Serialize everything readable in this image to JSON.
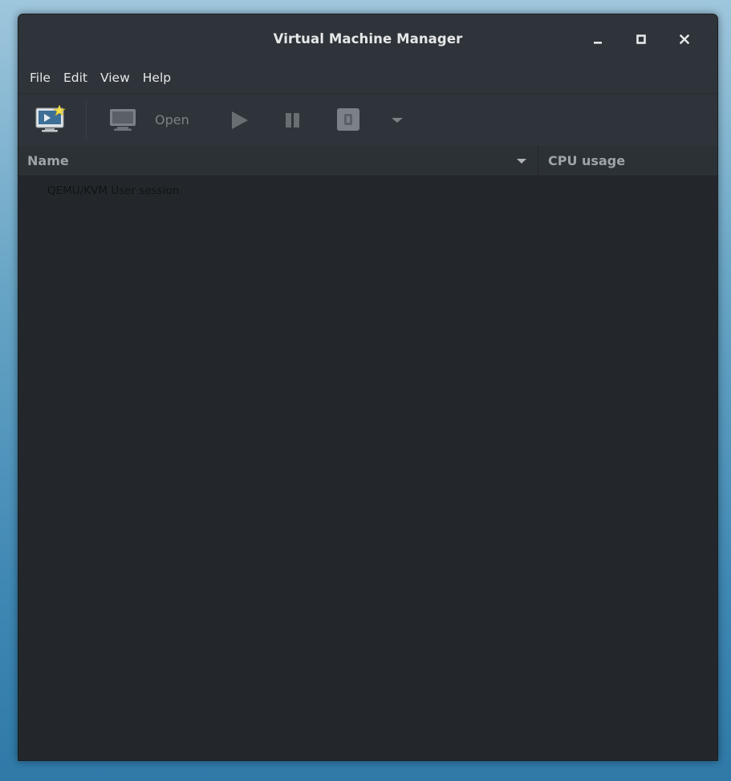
{
  "window": {
    "title": "Virtual Machine Manager"
  },
  "window_controls": {
    "minimize": "minimize-icon",
    "maximize": "maximize-icon",
    "close": "close-icon"
  },
  "menubar": {
    "items": [
      {
        "label": "File"
      },
      {
        "label": "Edit"
      },
      {
        "label": "View"
      },
      {
        "label": "Help"
      }
    ]
  },
  "toolbar": {
    "new_vm_icon": "new-vm-icon",
    "open_label": "Open",
    "open_icon": "monitor-icon",
    "run_icon": "play-icon",
    "pause_icon": "pause-icon",
    "shutdown_icon": "shutdown-icon",
    "dropdown_icon": "chevron-down-icon"
  },
  "columns": {
    "name": "Name",
    "cpu": "CPU usage"
  },
  "connections": [
    {
      "label": "QEMU/KVM User session"
    }
  ],
  "colors": {
    "background": "#23272b",
    "titlebar": "#2f343a",
    "text": "#e6e8e8",
    "muted": "#7c8185"
  }
}
